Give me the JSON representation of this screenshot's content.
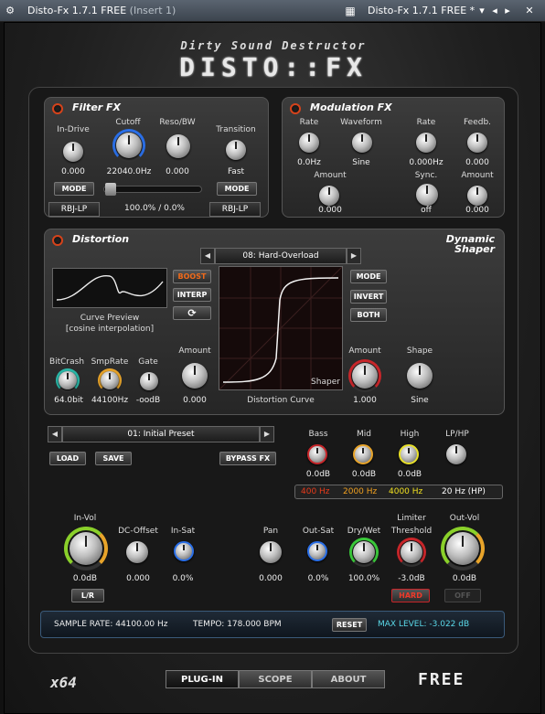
{
  "titlebar": {
    "left": "Disto-Fx 1.7.1 FREE",
    "left_sub": "(Insert 1)",
    "right": "Disto-Fx 1.7.1 FREE *",
    "gear": "gear-icon",
    "close": "✕"
  },
  "header": {
    "subtitle": "Dirty Sound Destructor",
    "logo": "DISTO::FX"
  },
  "filter": {
    "title": "Filter FX",
    "indrive_label": "In-Drive",
    "indrive": "0.000",
    "cutoff_label": "Cutoff",
    "cutoff": "22040.0Hz",
    "reso_label": "Reso/BW",
    "reso": "0.000",
    "trans_label": "Transition",
    "trans": "Fast",
    "mode": "MODE",
    "mode2": "MODE",
    "type1": "RBJ-LP",
    "type2": "RBJ-LP",
    "mix": "100.0% / 0.0%"
  },
  "modulation": {
    "title": "Modulation FX",
    "rate1_label": "Rate",
    "rate1": "0.0Hz",
    "waveform_label": "Waveform",
    "waveform": "Sine",
    "rate2_label": "Rate",
    "rate2": "0.000Hz",
    "feedb_label": "Feedb.",
    "feedb": "0.000",
    "amount1_label": "Amount",
    "amount1": "0.000",
    "sync_label": "Sync.",
    "sync": "off",
    "amount2_label": "Amount",
    "amount2": "0.000"
  },
  "distortion": {
    "title": "Distortion",
    "dyn": "Dynamic",
    "shaper_t": "Shaper",
    "preset": "08: Hard-Overload",
    "boost": "BOOST",
    "interp": "INTERP",
    "refresh": "refresh-icon",
    "curve_preview": "Curve Preview",
    "curve_interp": "[cosine interpolation]",
    "mode": "MODE",
    "invert": "INVERT",
    "both": "BOTH",
    "bitcrash_label": "BitCrash",
    "bitcrash": "64.0bit",
    "smprate_label": "SmpRate",
    "smprate": "44100Hz",
    "gate_label": "Gate",
    "gate": "-oodB",
    "amount_label": "Amount",
    "amount": "0.000",
    "shaper_label": "Shaper",
    "curve_label": "Distortion Curve",
    "amount2_label": "Amount",
    "amount2": "1.000",
    "shape_label": "Shape",
    "shape": "Sine"
  },
  "preset": {
    "name": "01: Initial Preset",
    "load": "LOAD",
    "save": "SAVE",
    "bypass": "BYPASS FX"
  },
  "eq": {
    "bass_label": "Bass",
    "bass": "0.0dB",
    "mid_label": "Mid",
    "mid": "0.0dB",
    "high_label": "High",
    "high": "0.0dB",
    "lphp_label": "LP/HP",
    "f1": "400 Hz",
    "f2": "2000 Hz",
    "f3": "4000 Hz",
    "f4": "20 Hz (HP)",
    "c1": "#e83a1a",
    "c2": "#f0a020",
    "c3": "#f0e020",
    "c4": "#ffffff"
  },
  "output": {
    "invol_label": "In-Vol",
    "invol": "0.0dB",
    "lr": "L/R",
    "dcoff_label": "DC-Offset",
    "dcoff": "0.000",
    "insat_label": "In-Sat",
    "insat": "0.0%",
    "pan_label": "Pan",
    "pan": "0.000",
    "outsat_label": "Out-Sat",
    "outsat": "0.0%",
    "drywet_label": "Dry/Wet",
    "drywet": "100.0%",
    "limiter_label": "Limiter",
    "threshold_label": "Threshold",
    "threshold": "-3.0dB",
    "hard": "HARD",
    "outvol_label": "Out-Vol",
    "outvol": "0.0dB",
    "off": "OFF"
  },
  "status": {
    "samplerate": "SAMPLE RATE: 44100.00 Hz",
    "tempo": "TEMPO: 178.000 BPM",
    "reset": "RESET",
    "maxlevel": "MAX LEVEL: -3.022 dB"
  },
  "footer": {
    "x64": "x64",
    "plugin": "PLUG-IN",
    "scope": "SCOPE",
    "about": "ABOUT",
    "free": "FREE"
  }
}
